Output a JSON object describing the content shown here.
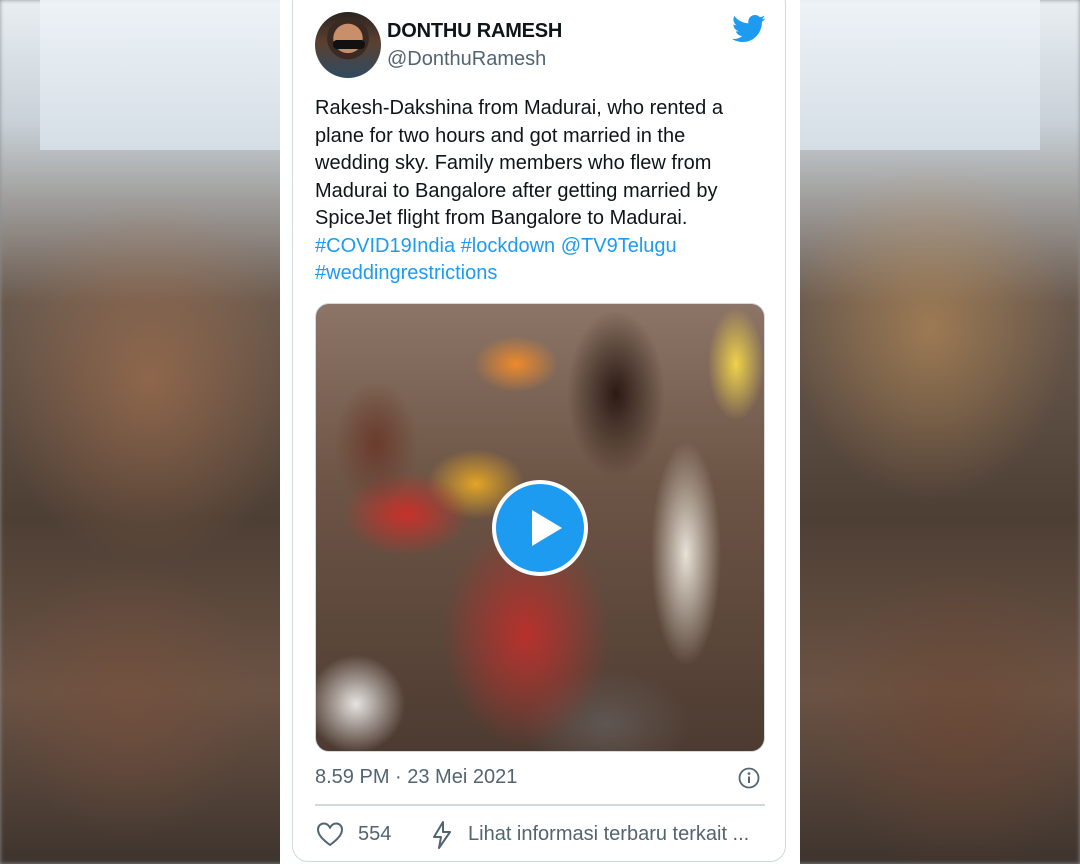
{
  "user": {
    "display_name": "DONTHU RAMESH",
    "handle": "@DonthuRamesh"
  },
  "tweet": {
    "lines": [
      "Rakesh-Dakshina from Madurai, who rented a",
      "plane for two hours and got married in the",
      "wedding sky. Family members who flew from",
      "Madurai to Bangalore after getting married by",
      "SpiceJet flight from Bangalore to Madurai."
    ],
    "hashtags": [
      "#COVID19India",
      "#lockdown",
      "@TV9Telugu",
      "#weddingrestrictions"
    ],
    "timestamp": "8.59 PM · 23 Mei 2021",
    "likes": "554",
    "info_link": "Lihat informasi terbaru terkait ..."
  },
  "icons": {
    "brand": "twitter-bird-icon",
    "play": "play-icon",
    "info": "info-icon",
    "like": "heart-icon",
    "bolt": "lightning-icon"
  },
  "colors": {
    "accent": "#1d9bf0",
    "text": "#0f1419",
    "muted": "#536471",
    "border": "#cfd9de"
  }
}
